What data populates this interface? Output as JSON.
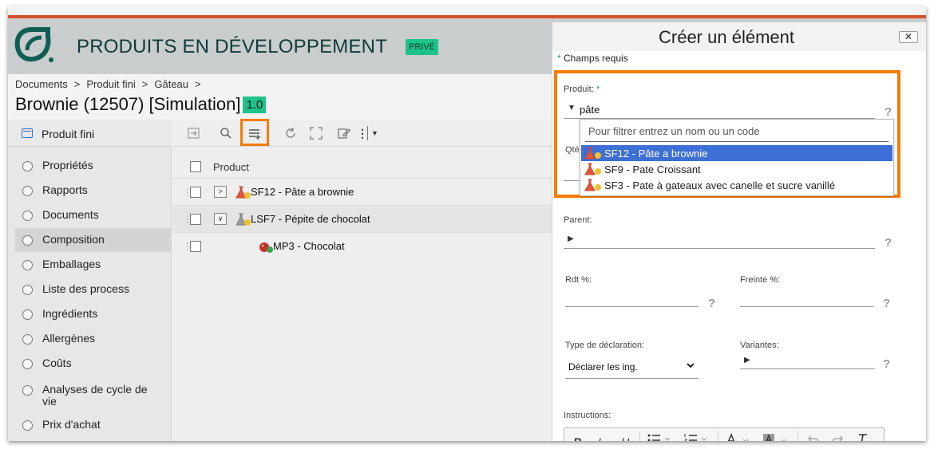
{
  "header": {
    "title": "PRODUITS EN DÉVELOPPEMENT",
    "privacy_badge": "PRIVÉ"
  },
  "breadcrumb": [
    "Documents",
    "Produit fini",
    "Gâteau"
  ],
  "entity": {
    "title": "Brownie (12507) [Simulation]",
    "version": "1.0"
  },
  "sidebar": {
    "header": "Produit fini",
    "items": [
      {
        "label": "Propriétés"
      },
      {
        "label": "Rapports"
      },
      {
        "label": "Documents"
      },
      {
        "label": "Composition",
        "active": true
      },
      {
        "label": "Emballages"
      },
      {
        "label": "Liste des process"
      },
      {
        "label": "Ingrédients"
      },
      {
        "label": "Allergènes"
      },
      {
        "label": "Coûts"
      },
      {
        "label": "Analyses de cycle de vie"
      },
      {
        "label": "Prix d'achat"
      }
    ]
  },
  "toolbar": {
    "icons": [
      "export-icon",
      "search-icon",
      "add-list-icon",
      "refresh-icon",
      "fullscreen-icon",
      "edit-icon",
      "more-icon",
      "dropdown-icon"
    ],
    "highlighted": "add-list-icon"
  },
  "list": {
    "column_header": "Product",
    "rows": [
      {
        "label": "SF12 - Pâte a brownie",
        "expander": ">",
        "icon": "semi-finished-icon"
      },
      {
        "label": "LSF7 - Pépite de chocolat",
        "expander": "∨",
        "icon": "local-semi-finished-icon"
      },
      {
        "label": "MP3 - Chocolat",
        "icon": "raw-material-icon"
      }
    ]
  },
  "dialog": {
    "title": "Créer un élément",
    "close_label": "✕",
    "required_note": "Champs requis",
    "produit": {
      "label": "Produit:",
      "value": "pâte",
      "filter_placeholder": "Pour filtrer entrez un nom ou un code",
      "options": [
        {
          "label": "SF12 - Pâte a brownie",
          "selected": true
        },
        {
          "label": "SF9 - Pate Croissant"
        },
        {
          "label": "SF3 - Pate à gateaux avec canelle et sucre vanillé"
        }
      ]
    },
    "qty_label_partial": "Qté",
    "parent_label": "Parent:",
    "rdt_label": "Rdt %:",
    "freinte_label": "Freinte %:",
    "declaration_label": "Type de déclaration:",
    "declaration_value": "Déclarer les ing.",
    "variantes_label": "Variantes:",
    "instructions_label": "Instructions:",
    "help_symbol": "?",
    "editor_buttons": [
      "B",
      "I",
      "U"
    ]
  },
  "colors": {
    "accent_orange": "#f57c00",
    "brand_green": "#1cc28a",
    "selection_blue": "#3d6fd6",
    "top_strip": "#d6502b"
  }
}
